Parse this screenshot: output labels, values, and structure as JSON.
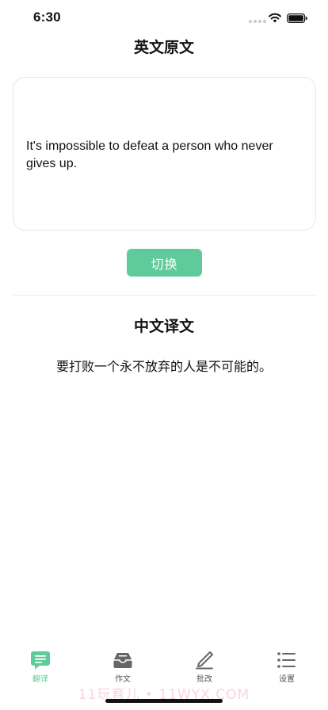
{
  "status_bar": {
    "time": "6:30"
  },
  "source": {
    "title": "英文原文",
    "text": "It's impossible to defeat a person who never gives up."
  },
  "switch_label": "切换",
  "translation": {
    "title": "中文译文",
    "text": "要打败一个永不放弃的人是不可能的。"
  },
  "tabs": [
    {
      "label": "翻译",
      "icon": "chat-bubble-icon",
      "active": true
    },
    {
      "label": "作文",
      "icon": "inbox-tray-icon",
      "active": false
    },
    {
      "label": "批改",
      "icon": "pen-icon",
      "active": false
    },
    {
      "label": "设置",
      "icon": "list-icon",
      "active": false
    }
  ],
  "watermark": "11玩育儿 • 11WYX.COM",
  "colors": {
    "accent": "#5fcb9b",
    "tab_inactive": "#555555",
    "card_border": "#e7e7e7"
  }
}
